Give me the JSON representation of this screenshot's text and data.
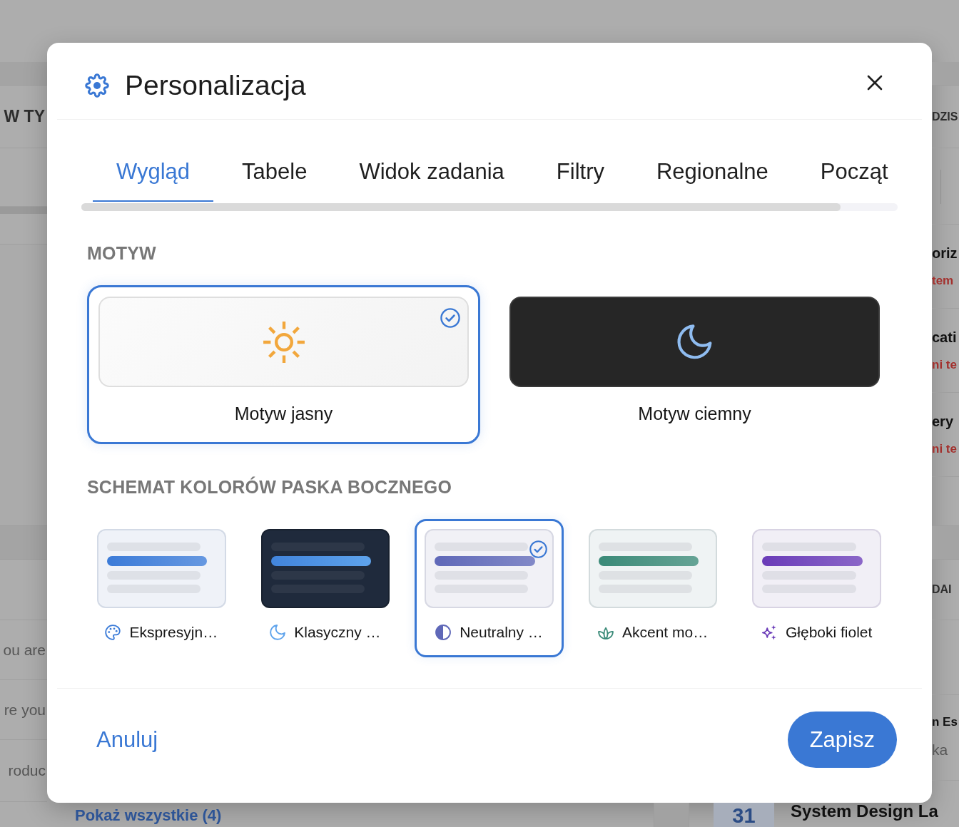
{
  "background_page": {
    "left_panel": {
      "header": "W TY",
      "rows": [
        "ou are",
        "re you",
        "roduc"
      ],
      "link": "Pokaż wszystkie (4)"
    },
    "right_panel": {
      "header": "DZIS",
      "tasks": [
        {
          "title": "oriz",
          "note": "tem"
        },
        {
          "title": "cati",
          "note": "ni te"
        },
        {
          "title": "ery",
          "note": "ni te"
        }
      ],
      "section_header": "DAI",
      "event": {
        "title": "n Es",
        "subtitle": "ka"
      },
      "calendar_entry": {
        "day": "31",
        "title": "System Design La"
      }
    }
  },
  "dialog": {
    "title": "Personalizacja",
    "tabs": [
      {
        "label": "Wygląd",
        "selected": true
      },
      {
        "label": "Tabele",
        "selected": false
      },
      {
        "label": "Widok zadania",
        "selected": false
      },
      {
        "label": "Filtry",
        "selected": false
      },
      {
        "label": "Regionalne",
        "selected": false
      },
      {
        "label": "Począt",
        "selected": false
      }
    ],
    "theme_section": {
      "heading": "MOTYW",
      "options": [
        {
          "kind": "light",
          "label": "Motyw jasny",
          "selected": true
        },
        {
          "kind": "dark",
          "label": "Motyw ciemny",
          "selected": false
        }
      ]
    },
    "sidebar_scheme_section": {
      "heading": "SCHEMAT KOLORÓW PASKA BOCZNEGO",
      "options": [
        {
          "kind": "light",
          "label": "Ekspresyjn…",
          "color": "#3b7bd8",
          "selected": false
        },
        {
          "kind": "dark",
          "label": "Klasyczny …",
          "color": "#5ea3ec",
          "selected": false
        },
        {
          "kind": "light",
          "label": "Neutralny …",
          "color": "#5f68b8",
          "selected": true
        },
        {
          "kind": "light",
          "label": "Akcent mo…",
          "color": "#3a8a78",
          "selected": false
        },
        {
          "kind": "light",
          "label": "Głęboki fiolet",
          "color": "#6a3bb8",
          "selected": false
        }
      ]
    },
    "footer": {
      "cancel_label": "Anuluj",
      "save_label": "Zapisz"
    }
  }
}
